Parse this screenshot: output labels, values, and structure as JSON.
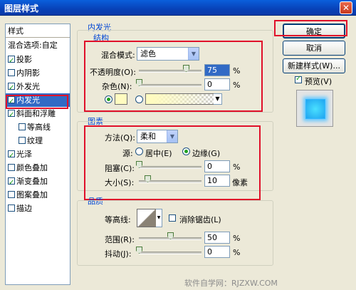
{
  "window": {
    "title": "图层样式",
    "close_glyph": "✕"
  },
  "sidebar": {
    "header": "样式",
    "blend_options": "混合选项:自定",
    "items": [
      {
        "label": "投影",
        "checked": true
      },
      {
        "label": "内阴影",
        "checked": false
      },
      {
        "label": "外发光",
        "checked": true
      },
      {
        "label": "内发光",
        "checked": true,
        "selected": true
      },
      {
        "label": "斜面和浮雕",
        "checked": true
      },
      {
        "label": "等高线",
        "checked": false,
        "indent": true
      },
      {
        "label": "纹理",
        "checked": false,
        "indent": true
      },
      {
        "label": "光泽",
        "checked": true
      },
      {
        "label": "颜色叠加",
        "checked": false
      },
      {
        "label": "渐变叠加",
        "checked": true
      },
      {
        "label": "图案叠加",
        "checked": false
      },
      {
        "label": "描边",
        "checked": false
      }
    ]
  },
  "panel": {
    "title": "内发光",
    "structure": {
      "legend": "结构",
      "blend_mode_label": "混合模式:",
      "blend_mode_value": "滤色",
      "opacity_label": "不透明度(O):",
      "opacity_value": "75",
      "opacity_level": 0.75,
      "noise_label": "杂色(N):",
      "noise_value": "0",
      "noise_level": 0,
      "unit": "%",
      "glow_color": "#fffbc0"
    },
    "elements": {
      "legend": "图素",
      "method_label": "方法(Q):",
      "method_value": "柔和",
      "source_label": "源:",
      "source_center": "居中(E)",
      "source_edge": "边缘(G)",
      "choke_label": "阻塞(C):",
      "choke_value": "0",
      "choke_level": 0,
      "size_label": "大小(S):",
      "size_value": "10",
      "size_unit": "像素",
      "unit": "%"
    },
    "quality": {
      "legend": "品质",
      "contour_label": "等高线:",
      "antialias_label": "消除锯齿(L)",
      "range_label": "范围(R):",
      "range_value": "50",
      "range_level": 0.5,
      "jitter_label": "抖动(J):",
      "jitter_value": "0",
      "jitter_level": 0,
      "unit": "%"
    }
  },
  "buttons": {
    "ok": "确定",
    "cancel": "取消",
    "new_style": "新建样式(W)...",
    "preview_label": "预览(V)"
  },
  "watermark": "软件自学网：RJZXW.COM",
  "colors": {
    "highlight": "#e0102a",
    "selection": "#316ac5",
    "accent": "#0046d5"
  }
}
